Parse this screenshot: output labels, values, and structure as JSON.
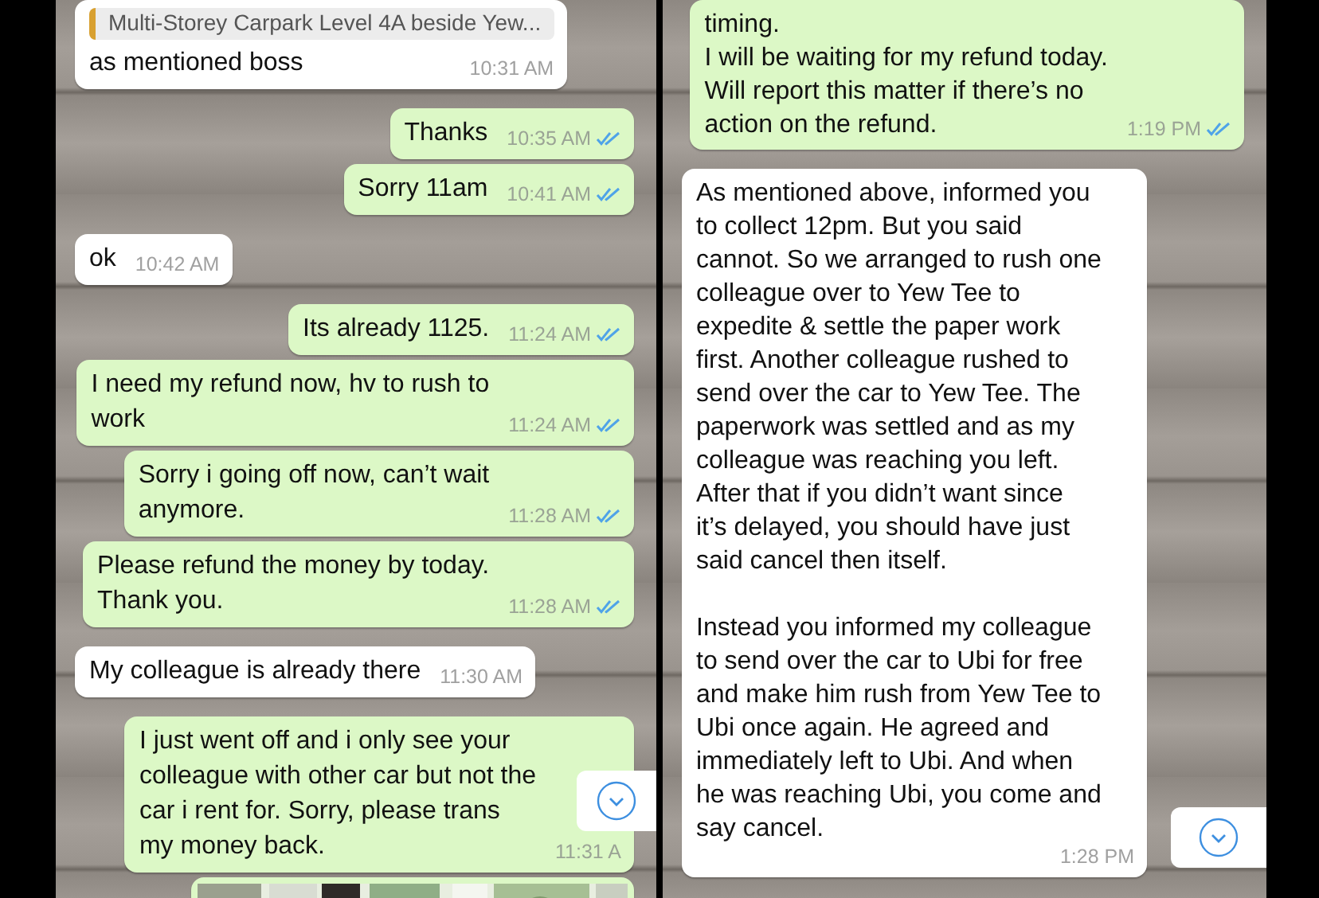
{
  "panels": [
    {
      "messages": [
        {
          "kind": "text",
          "outgoing": false,
          "quote": "Multi-Storey Carpark Level 4A beside Yew...",
          "paragraphs": [
            [
              "as mentioned boss"
            ]
          ],
          "time": "10:31 AM"
        },
        {
          "kind": "text",
          "outgoing": true,
          "paragraphs": [
            [
              "Thanks"
            ]
          ],
          "time": "10:35 AM",
          "read": true
        },
        {
          "kind": "text",
          "outgoing": true,
          "paragraphs": [
            [
              "Sorry 11am"
            ]
          ],
          "time": "10:41 AM",
          "read": true
        },
        {
          "kind": "text",
          "outgoing": false,
          "paragraphs": [
            [
              "ok"
            ]
          ],
          "time": "10:42 AM"
        },
        {
          "kind": "text",
          "outgoing": true,
          "paragraphs": [
            [
              "Its already 1125."
            ]
          ],
          "time": "11:24 AM",
          "read": true
        },
        {
          "kind": "text",
          "outgoing": true,
          "paragraphs": [
            [
              "I need my refund now, hv to rush to",
              "work"
            ]
          ],
          "time": "11:24 AM",
          "read": true
        },
        {
          "kind": "text",
          "outgoing": true,
          "paragraphs": [
            [
              "Sorry i going off now, can’t wait",
              "anymore."
            ]
          ],
          "time": "11:28 AM",
          "read": true
        },
        {
          "kind": "text",
          "outgoing": true,
          "paragraphs": [
            [
              "Please refund the money by today.",
              "Thank you."
            ]
          ],
          "time": "11:28 AM",
          "read": true
        },
        {
          "kind": "text",
          "outgoing": false,
          "paragraphs": [
            [
              "My colleague is already there"
            ]
          ],
          "time": "11:30 AM"
        },
        {
          "kind": "text",
          "outgoing": true,
          "paragraphs": [
            [
              "I just went off and i only see your",
              "colleague with other car but not the",
              "car i rent for. Sorry, please trans",
              "my money back."
            ]
          ],
          "time": "11:31 A"
        },
        {
          "kind": "picture",
          "outgoing": true
        }
      ]
    },
    {
      "messages": [
        {
          "kind": "text",
          "outgoing": true,
          "paragraphs": [
            [
              "timing.",
              "I will be waiting for my refund today.",
              "Will report this matter if there’s no",
              "action on the refund."
            ]
          ],
          "time": "1:19 PM",
          "read": true
        },
        {
          "kind": "text",
          "outgoing": false,
          "paragraphs": [
            [
              "As mentioned above, informed you",
              "to collect 12pm. But you said",
              "cannot. So we arranged to rush one",
              "colleague over to Yew Tee to",
              "expedite & settle the paper work",
              "first. Another colleague rushed to",
              "send over the car to Yew Tee. The",
              "paperwork was settled and as my",
              "colleague was reaching you left.",
              "After that if you didn’t want since",
              "it’s delayed, you should have just",
              "said cancel then itself."
            ],
            [
              "Instead you informed my colleague",
              "to send over the car to Ubi for free",
              "and make him rush from Yew Tee to",
              "Ubi once again. He agreed and",
              "immediately left to Ubi. And when",
              "he was reaching Ubi, you come and",
              "say cancel."
            ]
          ],
          "time": "1:28 PM"
        }
      ]
    }
  ]
}
